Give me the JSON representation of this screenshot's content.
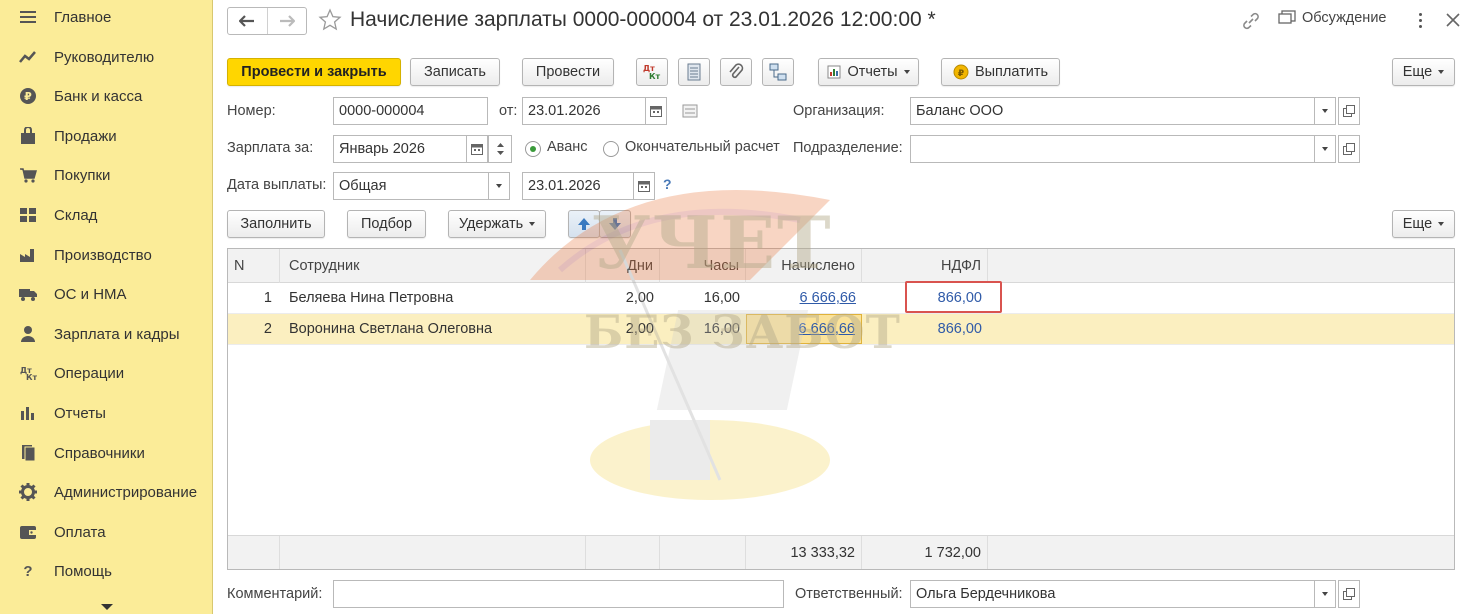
{
  "sidebar": {
    "items": [
      {
        "label": "Главное",
        "icon": "menu-icon"
      },
      {
        "label": "Руководителю",
        "icon": "trend-icon"
      },
      {
        "label": "Банк и касса",
        "icon": "ruble-coin-icon"
      },
      {
        "label": "Продажи",
        "icon": "shopping-bag-icon"
      },
      {
        "label": "Покупки",
        "icon": "cart-icon"
      },
      {
        "label": "Склад",
        "icon": "warehouse-icon"
      },
      {
        "label": "Производство",
        "icon": "factory-icon"
      },
      {
        "label": "ОС и НМА",
        "icon": "truck-icon"
      },
      {
        "label": "Зарплата и кадры",
        "icon": "person-icon"
      },
      {
        "label": "Операции",
        "icon": "dt-kt-icon"
      },
      {
        "label": "Отчеты",
        "icon": "bar-chart-icon"
      },
      {
        "label": "Справочники",
        "icon": "books-icon"
      },
      {
        "label": "Администрирование",
        "icon": "gear-icon"
      },
      {
        "label": "Оплата",
        "icon": "wallet-icon"
      },
      {
        "label": "Помощь",
        "icon": "question-icon"
      }
    ]
  },
  "header": {
    "title": "Начисление зарплаты 0000-000004 от 23.01.2026 12:00:00 *",
    "discuss_label": "Обсуждение"
  },
  "toolbar": {
    "post_close": "Провести и закрыть",
    "save": "Записать",
    "post": "Провести",
    "reports": "Отчеты",
    "pay": "Выплатить",
    "more": "Еще"
  },
  "form": {
    "number_label": "Номер:",
    "number_value": "0000-000004",
    "from_label": "от:",
    "from_value": "23.01.2026",
    "org_label": "Организация:",
    "org_value": "Баланс ООО",
    "salary_for_label": "Зарплата за:",
    "salary_for_value": "Январь 2026",
    "advance_label": "Аванс",
    "final_label": "Окончательный расчет",
    "dept_label": "Подразделение:",
    "dept_value": "",
    "paydate_label": "Дата выплаты:",
    "paydate_type": "Общая",
    "paydate_value": "23.01.2026",
    "help": "?"
  },
  "table_toolbar": {
    "fill": "Заполнить",
    "select": "Подбор",
    "withhold": "Удержать",
    "more": "Еще"
  },
  "table": {
    "columns": [
      "N",
      "Сотрудник",
      "Дни",
      "Часы",
      "Начислено",
      "НДФЛ"
    ],
    "rows": [
      {
        "n": "1",
        "employee": "Беляева Нина Петровна",
        "days": "2,00",
        "hours": "16,00",
        "accrued": "6 666,66",
        "ndfl": "866,00"
      },
      {
        "n": "2",
        "employee": "Воронина Светлана Олеговна",
        "days": "2,00",
        "hours": "16,00",
        "accrued": "6 666,66",
        "ndfl": "866,00"
      }
    ],
    "totals": {
      "accrued": "13 333,32",
      "ndfl": "1 732,00"
    }
  },
  "footer": {
    "comment_label": "Комментарий:",
    "comment_value": "",
    "responsible_label": "Ответственный:",
    "responsible_value": "Ольга Бердечникова"
  },
  "watermark": {
    "line1": "УЧЕТ",
    "line2": "БЕЗ ЗАБОТ"
  },
  "colors": {
    "sidebar": "#fbec98",
    "primary": "#ffd600",
    "selected_row": "#fbefc0",
    "link": "#2f5aa8",
    "highlight_box": "#d9534f"
  }
}
